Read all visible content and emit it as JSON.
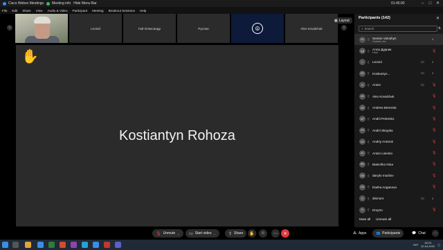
{
  "titlebar": {
    "app_name": "Cisco Webex Meetings",
    "meeting_info": "Meeting info",
    "hide_menu": "Hide Menu Bar",
    "time": "01:45:00"
  },
  "menu": [
    "File",
    "Edit",
    "Share",
    "View",
    "Audio & Video",
    "Participant",
    "Meeting",
    "Breakout Sessions",
    "Help"
  ],
  "filmstrip": {
    "tiles": [
      {
        "label": ""
      },
      {
        "label": "Leonid"
      },
      {
        "label": "Гай Олександр"
      },
      {
        "label": "Руслан"
      },
      {
        "label": ""
      },
      {
        "label": "Alex Kovalchuk"
      }
    ],
    "layout_label": "Layout"
  },
  "stage": {
    "active_speaker": "Kostiantyn Rohoza"
  },
  "participants": {
    "header": "Participants (142)",
    "search_placeholder": "Search",
    "list": [
      {
        "initials": "SV",
        "name": "Semen Voloshyn",
        "sub": "Cohost, me",
        "mic": "on",
        "video": ""
      },
      {
        "initials": "АД",
        "name": "Алла Дудник",
        "sub": "Host",
        "mic": "off",
        "video": ""
      },
      {
        "initials": "L",
        "name": "Leonid",
        "sub": "",
        "mic": "on",
        "video": "video"
      },
      {
        "initials": "KR",
        "name": "Kostiantyn...",
        "sub": "",
        "mic": "on",
        "video": "video"
      },
      {
        "initials": "A",
        "name": "Anton",
        "sub": "",
        "mic": "off",
        "video": "video"
      },
      {
        "initials": "AK",
        "name": "Alex Kovalchuk",
        "sub": "",
        "mic": "off",
        "video": ""
      },
      {
        "initials": "AB",
        "name": "Andrew Bereziuk",
        "sub": "",
        "mic": "off",
        "video": ""
      },
      {
        "initials": "AP",
        "name": "Andrii Petrenko",
        "sub": "",
        "mic": "off",
        "video": ""
      },
      {
        "initials": "AS",
        "name": "Andrii Skrypka",
        "sub": "",
        "mic": "off",
        "video": ""
      },
      {
        "initials": "AA",
        "name": "Andriy Antoruk",
        "sub": "",
        "mic": "off",
        "video": ""
      },
      {
        "initials": "AL",
        "name": "Anton Lisenko",
        "sub": "",
        "mic": "off",
        "video": ""
      },
      {
        "initials": "BN",
        "name": "Batechko Nina",
        "sub": "",
        "mic": "off",
        "video": ""
      },
      {
        "initials": "DM",
        "name": "danylo mazitov",
        "sub": "",
        "mic": "off",
        "video": ""
      },
      {
        "initials": "DA",
        "name": "Dasha Anganova",
        "sub": "",
        "mic": "off",
        "video": ""
      },
      {
        "initials": "D",
        "name": "dismont",
        "sub": "",
        "mic": "on",
        "video": "video"
      },
      {
        "initials": "D",
        "name": "Dmytro",
        "sub": "",
        "mic": "off",
        "video": ""
      }
    ],
    "mute_all": "Mute all",
    "unmute_all": "Unmute all"
  },
  "toolbar": {
    "unmute": "Unmute",
    "start_video": "Start video",
    "share": "Share",
    "apps": "Apps",
    "participants": "Participants",
    "chat": "Chat"
  },
  "taskbar": {
    "language": "УКР",
    "time": "18:24",
    "date": "20.04.2022"
  },
  "colors": {
    "end_call": "#e0393e",
    "muted_mic": "#e04848",
    "raised_hand": "#f0b63a"
  }
}
